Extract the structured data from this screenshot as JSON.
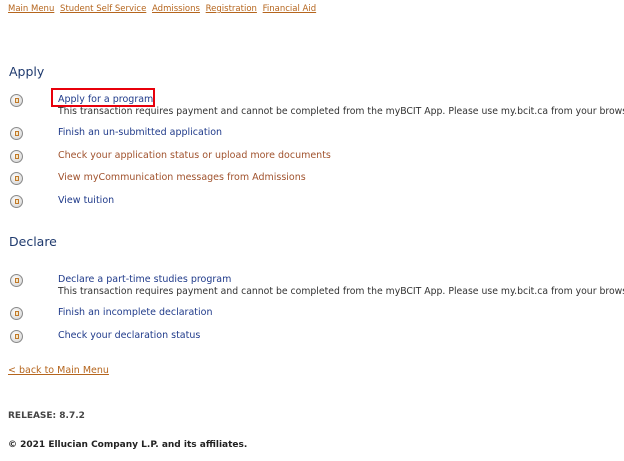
{
  "nav": {
    "main_menu": "Main Menu",
    "student_self_service": "Student Self Service",
    "admissions": "Admissions",
    "registration": "Registration",
    "financial_aid": "Financial Aid"
  },
  "apply": {
    "title": "Apply",
    "items": [
      {
        "label": "Apply for a program",
        "note": "This transaction requires payment and cannot be completed from the myBCIT App. Please use my.bcit.ca from your browser."
      },
      {
        "label": "Finish an un-submitted application"
      },
      {
        "label": "Check your application status or upload more documents"
      },
      {
        "label": "View myCommunication messages from Admissions"
      },
      {
        "label": "View tuition"
      }
    ]
  },
  "declare": {
    "title": "Declare",
    "items": [
      {
        "label": "Declare a part-time studies program",
        "note": "This transaction requires payment and cannot be completed from the myBCIT App. Please use my.bcit.ca from your browser."
      },
      {
        "label": "Finish an incomplete declaration"
      },
      {
        "label": "Check your declaration status"
      }
    ]
  },
  "footer": {
    "back_link": "< back to Main Menu",
    "release": "RELEASE: 8.7.2",
    "copyright": "© 2021 Ellucian Company L.P. and its affiliates."
  },
  "colors": {
    "link_brown": "#b5651d",
    "highlight_red": "#e8000b",
    "heading_blue": "#1f3a6e"
  }
}
